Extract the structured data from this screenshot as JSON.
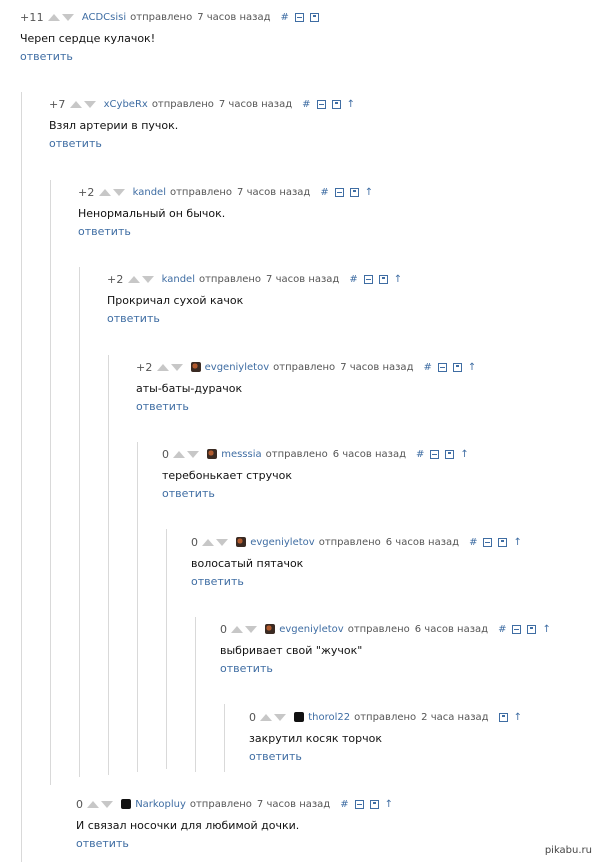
{
  "comments": [
    {
      "score": "+11",
      "author": "ACDCsisi",
      "meta": "отправлено",
      "time": "7 часов назад",
      "text": "Череп сердце кулачок!",
      "reply": "ответить",
      "hash": "#"
    },
    {
      "score": "+7",
      "author": "xCybeRx",
      "meta": "отправлено",
      "time": "7 часов назад",
      "text": "Взял артерии в пучок.",
      "reply": "ответить",
      "hash": "#",
      "up": "↑"
    },
    {
      "score": "+2",
      "author": "kandel",
      "meta": "отправлено",
      "time": "7 часов назад",
      "text": "Ненормальный он бычок.",
      "reply": "ответить",
      "hash": "#",
      "up": "↑"
    },
    {
      "score": "+2",
      "author": "kandel",
      "meta": "отправлено",
      "time": "7 часов назад",
      "text": "Прокричал сухой качок",
      "reply": "ответить",
      "hash": "#",
      "up": "↑"
    },
    {
      "score": "+2",
      "author": "evgeniyletov",
      "meta": "отправлено",
      "time": "7 часов назад",
      "text": "аты-баты-дурачок",
      "reply": "ответить",
      "hash": "#",
      "up": "↑"
    },
    {
      "score": "0",
      "author": "messsia",
      "meta": "отправлено",
      "time": "6 часов назад",
      "text": "теребонькает стручок",
      "reply": "ответить",
      "hash": "#",
      "up": "↑"
    },
    {
      "score": "0",
      "author": "evgeniyletov",
      "meta": "отправлено",
      "time": "6 часов назад",
      "text": "волосатый пятачок",
      "reply": "ответить",
      "hash": "#",
      "up": "↑"
    },
    {
      "score": "0",
      "author": "evgeniyletov",
      "meta": "отправлено",
      "time": "6 часов назад",
      "text": "выбривает свой \"жучок\"",
      "reply": "ответить",
      "hash": "#",
      "up": "↑"
    },
    {
      "score": "0",
      "author": "thorol22",
      "meta": "отправлено",
      "time": "2 часа назад",
      "text": "закрутил косяк торчок",
      "reply": "ответить",
      "up": "↑"
    },
    {
      "score": "0",
      "author": "Narkopluy",
      "meta": "отправлено",
      "time": "7 часов назад",
      "text": "И связал носочки для любимой дочки.",
      "reply": "ответить",
      "hash": "#",
      "up": "↑"
    }
  ],
  "watermark": "pikabu.ru"
}
